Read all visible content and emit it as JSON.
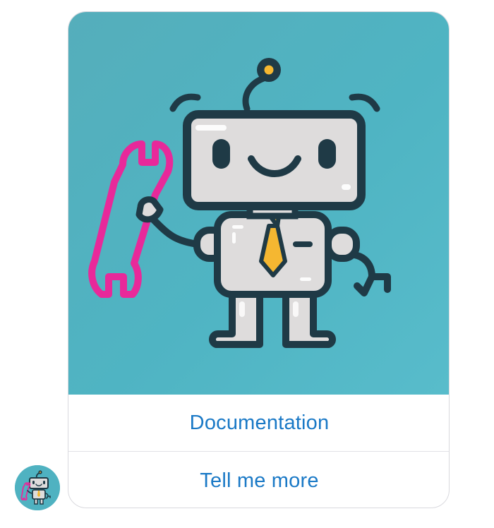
{
  "message_card": {
    "image_icon": "robot-holding-wrench-illustration",
    "actions": [
      {
        "label": "Documentation"
      },
      {
        "label": "Tell me more"
      }
    ]
  },
  "avatar": {
    "icon": "robot-avatar-icon"
  },
  "colors": {
    "image_background": "#4fb4c3",
    "robot_outline": "#1f3a46",
    "robot_body": "#dedcdc",
    "wrench": "#e8299a",
    "tie": "#f5b731",
    "link_blue": "#1a79c6"
  }
}
